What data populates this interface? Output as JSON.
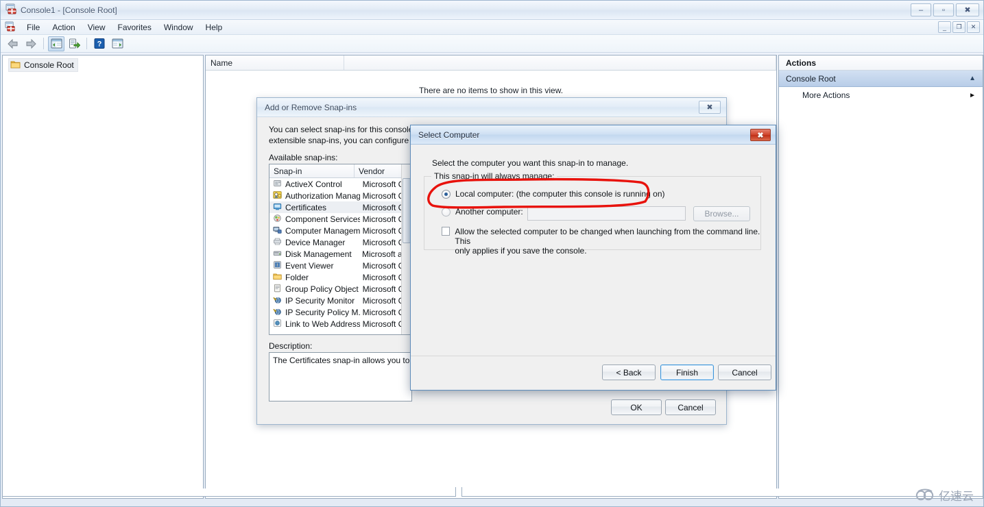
{
  "window": {
    "title": "Console1 - [Console Root]",
    "icon": "mmc-console-icon",
    "controls": {
      "minimize": "–",
      "maximize": "▫",
      "close": "✖"
    },
    "mdi_controls": {
      "minimize": "_",
      "restore": "❐",
      "close": "✕"
    }
  },
  "menubar": {
    "icon": "mmc-console-icon",
    "items": [
      {
        "label": "File"
      },
      {
        "label": "Action"
      },
      {
        "label": "View"
      },
      {
        "label": "Favorites"
      },
      {
        "label": "Window"
      },
      {
        "label": "Help"
      }
    ]
  },
  "toolbar": {
    "buttons": [
      {
        "name": "back-button",
        "icon": "back-arrow-icon"
      },
      {
        "name": "forward-button",
        "icon": "forward-arrow-icon"
      },
      {
        "name": "show-hide-console-tree-button",
        "icon": "tree-pane-icon"
      },
      {
        "name": "export-list-button",
        "icon": "export-list-icon"
      },
      {
        "name": "help-button",
        "icon": "question-mark-icon"
      },
      {
        "name": "show-hide-action-pane-button",
        "icon": "action-pane-icon"
      }
    ]
  },
  "tree_pane": {
    "items": [
      {
        "label": "Console Root",
        "icon": "folder-icon",
        "selected": true
      }
    ]
  },
  "main_pane": {
    "columns": [
      "Name",
      ""
    ],
    "empty_message": "There are no items to show in this view."
  },
  "actions_pane": {
    "title": "Actions",
    "group": {
      "label": "Console Root",
      "expander": "▲"
    },
    "items": [
      {
        "label": "More Actions",
        "submenu_arrow": "►"
      }
    ]
  },
  "add_remove_dialog": {
    "title": "Add or Remove Snap-ins",
    "close_label": "✖",
    "intro_line1": "You can select snap-ins for this console fro",
    "intro_line2": "extensible snap-ins, you can configure whi",
    "available_label": "Available snap-ins:",
    "list_columns": [
      "Snap-in",
      "Vendor"
    ],
    "snapins": [
      {
        "name": "ActiveX Control",
        "vendor": "Microsoft Cor",
        "icon": "activex-icon",
        "selected": false
      },
      {
        "name": "Authorization Manager",
        "vendor": "Microsoft Cor",
        "icon": "authmgr-icon",
        "selected": false
      },
      {
        "name": "Certificates",
        "vendor": "Microsoft Cor",
        "icon": "certificates-icon",
        "selected": true
      },
      {
        "name": "Component Services",
        "vendor": "Microsoft Cor",
        "icon": "component-icon",
        "selected": false
      },
      {
        "name": "Computer Managem...",
        "vendor": "Microsoft Cor",
        "icon": "computer-mgmt-icon",
        "selected": false
      },
      {
        "name": "Device Manager",
        "vendor": "Microsoft Cor",
        "icon": "device-mgr-icon",
        "selected": false
      },
      {
        "name": "Disk Management",
        "vendor": "Microsoft and",
        "icon": "disk-mgmt-icon",
        "selected": false
      },
      {
        "name": "Event Viewer",
        "vendor": "Microsoft Cor",
        "icon": "event-viewer-icon",
        "selected": false
      },
      {
        "name": "Folder",
        "vendor": "Microsoft Cor",
        "icon": "folder-icon",
        "selected": false
      },
      {
        "name": "Group Policy Object ...",
        "vendor": "Microsoft Cor",
        "icon": "gpo-icon",
        "selected": false
      },
      {
        "name": "IP Security Monitor",
        "vendor": "Microsoft Cor",
        "icon": "ipsec-monitor-icon",
        "selected": false
      },
      {
        "name": "IP Security Policy M...",
        "vendor": "Microsoft Cor",
        "icon": "ipsec-policy-icon",
        "selected": false
      },
      {
        "name": "Link to Web Address",
        "vendor": "Microsoft Cor",
        "icon": "web-link-icon",
        "selected": false
      }
    ],
    "description_label": "Description:",
    "description_text": "The Certificates snap-in allows you to bro",
    "ok_label": "OK",
    "cancel_label": "Cancel"
  },
  "select_computer_dialog": {
    "title": "Select Computer",
    "close_label": "✖",
    "prompt": "Select the computer you want this snap-in to manage.",
    "group_label": "This snap-in will always manage:",
    "local_option": "Local computer:  (the computer this console is running on)",
    "local_selected": true,
    "another_option": "Another computer:",
    "another_selected": false,
    "another_value": "",
    "browse_label": "Browse...",
    "allow_change_checkbox": {
      "checked": false,
      "line1": "Allow the selected computer to be changed when launching from the command line.  This",
      "line2": "only applies if you save the console."
    },
    "back_label": "< Back",
    "finish_label": "Finish",
    "cancel_label": "Cancel",
    "finish_is_default": true
  },
  "annotation": {
    "shape": "hand-drawn-red-ellipse",
    "color": "#e8120c",
    "targets": "local-computer-radio-option"
  },
  "watermark": {
    "text": "亿速云",
    "icon": "cloud-icon",
    "color": "#a3adbc"
  }
}
